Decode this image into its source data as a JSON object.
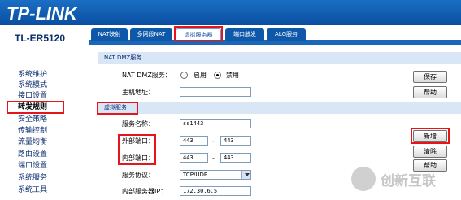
{
  "brand": "TP-LINK",
  "model": "TL-ER5120",
  "tabs": [
    {
      "label": "NAT映射"
    },
    {
      "label": "多网段NAT"
    },
    {
      "label": "虚拟服务器"
    },
    {
      "label": "端口触发"
    },
    {
      "label": "ALG服务"
    }
  ],
  "sidebar": {
    "items": [
      {
        "label": "系统维护"
      },
      {
        "label": "系统模式"
      },
      {
        "label": "接口设置"
      },
      {
        "label": "转发规则"
      },
      {
        "label": "安全策略"
      },
      {
        "label": "传输控制"
      },
      {
        "label": "流量均衡"
      },
      {
        "label": "路由设置"
      },
      {
        "label": "端口设置"
      },
      {
        "label": "系统服务"
      },
      {
        "label": "系统工具"
      }
    ]
  },
  "dmz": {
    "section_title": "NAT DMZ服务",
    "service_label": "NAT DMZ服务：",
    "enable_label": "启用",
    "disable_label": "禁用",
    "selected": "禁用",
    "host_label": "主机地址：",
    "host_value": "",
    "save_label": "保存",
    "help_label": "帮助"
  },
  "virtual": {
    "section_title": "虚拟服务",
    "name_label": "服务名称：",
    "name_value": "ss1443",
    "ext_port_label": "外部端口：",
    "ext_port_from": "443",
    "ext_port_to": "443",
    "int_port_label": "内部端口：",
    "int_port_from": "443",
    "int_port_to": "443",
    "protocol_label": "服务协议：",
    "protocol_value": "TCP/UDP",
    "ip_label": "内部服务器IP：",
    "ip_value": "172.30.6.5",
    "dash": "-",
    "add_label": "新增",
    "clear_label": "清除",
    "help_label": "帮助"
  },
  "watermark": "创新互联",
  "colors": {
    "header": "#0b4ea0",
    "section_bg": "#d9e6f6",
    "highlight": "#e8141c"
  }
}
